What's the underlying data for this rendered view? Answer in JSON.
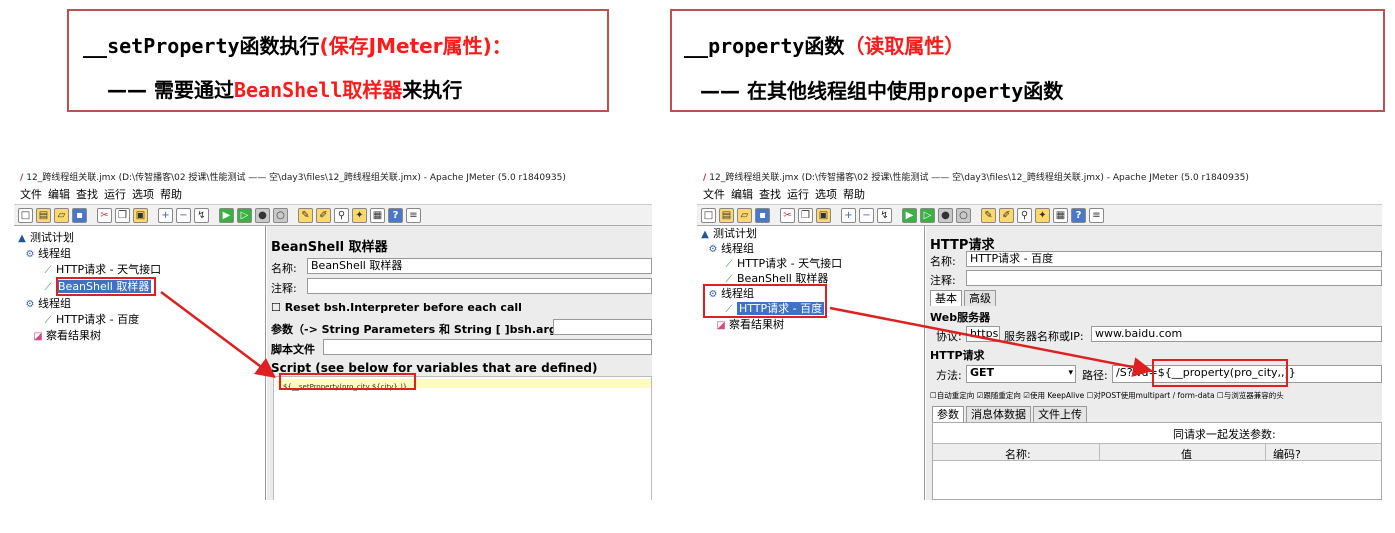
{
  "left_callout": {
    "line1_func": "__setProperty",
    "line1_text": "函数执行",
    "line1_red": "(保存JMeter属性)：",
    "line2_prefix": "—— 需要通过",
    "line2_red": "BeanShell",
    "line2_red2": "取样器",
    "line2_suffix": "来执行"
  },
  "right_callout": {
    "line1_func": "__property",
    "line1_text": "函数",
    "line1_red": "（读取属性）",
    "line2_prefix": "—— 在其他线程组中使用",
    "line2_func": "property",
    "line2_suffix": "函数"
  },
  "window_title": "12_跨线程组关联.jmx (D:\\传智播客\\02 授课\\性能测试 —— 空\\day3\\files\\12_跨线程组关联.jmx) - Apache JMeter (5.0 r1840935)",
  "menu": [
    "文件",
    "编辑",
    "查找",
    "运行",
    "选项",
    "帮助"
  ],
  "toolbar_icons": [
    "new-icon",
    "templates-icon",
    "open-icon",
    "save-icon",
    "cut-icon",
    "copy-icon",
    "paste-icon",
    "expand-icon",
    "collapse-icon",
    "toggle-icon",
    "start-icon",
    "start-no-pause-icon",
    "stop-icon",
    "shutdown-icon",
    "clear-icon",
    "clear-all-icon",
    "search-icon",
    "reset-search-icon",
    "function-helper-icon",
    "help-icon",
    "log-icon"
  ],
  "left_window": {
    "tree": {
      "plan": "测试计划",
      "thread_group_1": "线程组",
      "http_weather": "HTTP请求 - 天气接口",
      "beanshell": "BeanShell 取样器",
      "thread_group_2": "线程组",
      "http_baidu": "HTTP请求 - 百度",
      "result_tree": "察看结果树"
    },
    "panel": {
      "title": "BeanShell 取样器",
      "name_label": "名称:",
      "name_value": "BeanShell 取样器",
      "comment_label": "注释:",
      "reset_label": "Reset bsh.Interpreter before each call",
      "params_label": "参数（-> String Parameters 和 String [ ]bsh.args）",
      "script_file_label": "脚本文件",
      "script_label": "Script (see below for variables that are defined)",
      "script_code": "${__setProperty(pro_city,${city},)}"
    }
  },
  "right_window": {
    "tree": {
      "plan": "测试计划",
      "thread_group_1": "线程组",
      "http_weather": "HTTP请求 - 天气接口",
      "beanshell": "BeanShell 取样器",
      "thread_group_2": "线程组",
      "http_baidu": "HTTP请求 - 百度",
      "result_tree": "察看结果树"
    },
    "panel": {
      "title": "HTTP请求",
      "name_label": "名称:",
      "name_value": "HTTP请求 - 百度",
      "comment_label": "注释:",
      "tab_basic": "基本",
      "tab_advanced": "高级",
      "web_server": "Web服务器",
      "protocol_label": "协议:",
      "protocol_value": "https",
      "server_label": "服务器名称或IP:",
      "server_value": "www.baidu.com",
      "http_request": "HTTP请求",
      "method_label": "方法:",
      "method_value": "GET",
      "path_label": "路径:",
      "path_value": "/S?wd=${__property(pro_city,,)}",
      "options": [
        "自动重定向",
        "跟随重定向",
        "使用 KeepAlive",
        "对POST使用multipart / form-data",
        "与浏览器兼容的头"
      ],
      "subtab_params": "参数",
      "subtab_body": "消息体数据",
      "subtab_files": "文件上传",
      "send_params": "同请求一起发送参数:",
      "col_name": "名称:",
      "col_value": "值",
      "col_encode": "编码?"
    }
  },
  "colors": {
    "callout_border": "#c0504d",
    "highlight_red": "#ff1a1a",
    "arrow_red": "#e02020",
    "selection": "#3f72c6"
  }
}
